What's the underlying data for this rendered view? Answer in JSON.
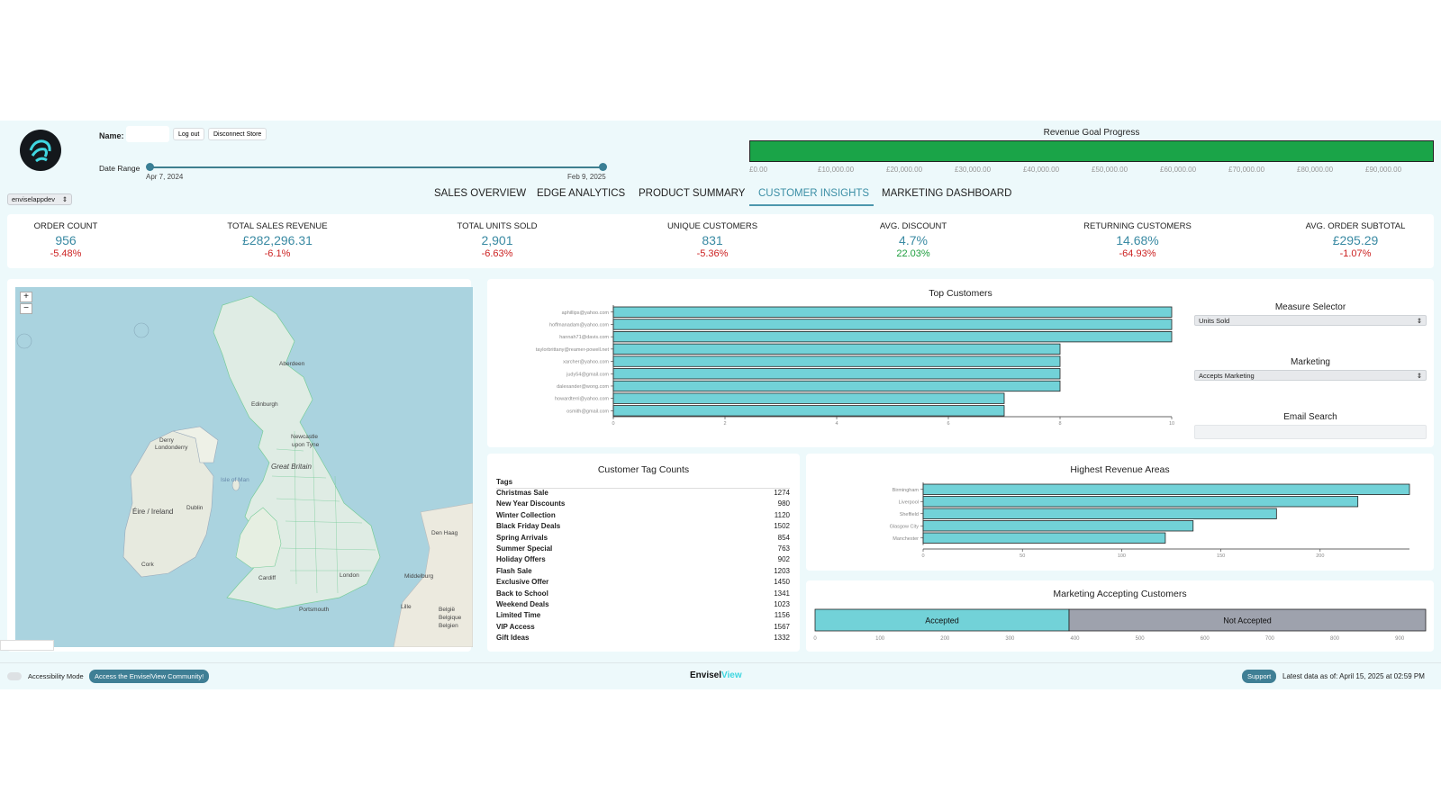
{
  "header": {
    "name_label": "Name:",
    "logout_label": "Log out",
    "disconnect_label": "Disconnect Store",
    "date_range_label": "Date Range",
    "date_start": "Apr 7, 2024",
    "date_end": "Feb 9, 2025",
    "store_select": "enviselappdev"
  },
  "goal": {
    "title": "Revenue Goal Progress",
    "progress_fraction": 1.0,
    "ticks": [
      "£0.00",
      "£10,000.00",
      "£20,000.00",
      "£30,000.00",
      "£40,000.00",
      "£50,000.00",
      "£60,000.00",
      "£70,000.00",
      "£80,000.00",
      "£90,000.00"
    ]
  },
  "tabs": [
    {
      "label": "SALES OVERVIEW",
      "active": false
    },
    {
      "label": "EDGE ANALYTICS",
      "active": false
    },
    {
      "label": "PRODUCT SUMMARY",
      "active": false
    },
    {
      "label": "CUSTOMER INSIGHTS",
      "active": true
    },
    {
      "label": "MARKETING DASHBOARD",
      "active": false
    }
  ],
  "kpis": [
    {
      "label": "ORDER COUNT",
      "value": "956",
      "change": "-5.48%",
      "trend": "neg"
    },
    {
      "label": "TOTAL SALES REVENUE",
      "value": "£282,296.31",
      "change": "-6.1%",
      "trend": "neg"
    },
    {
      "label": "TOTAL UNITS SOLD",
      "value": "2,901",
      "change": "-6.63%",
      "trend": "neg"
    },
    {
      "label": "UNIQUE CUSTOMERS",
      "value": "831",
      "change": "-5.36%",
      "trend": "neg"
    },
    {
      "label": "AVG. DISCOUNT",
      "value": "4.7%",
      "change": "22.03%",
      "trend": "pos"
    },
    {
      "label": "RETURNING CUSTOMERS",
      "value": "14.68%",
      "change": "-64.93%",
      "trend": "neg"
    },
    {
      "label": "AVG. ORDER SUBTOTAL",
      "value": "£295.29",
      "change": "-1.07%",
      "trend": "neg"
    }
  ],
  "map": {
    "zoom_in": "+",
    "zoom_out": "−",
    "labels": [
      {
        "text": "Aberdeen",
        "kind": "city"
      },
      {
        "text": "Edinburgh",
        "kind": "city"
      },
      {
        "text": "Newcastle",
        "kind": "city"
      },
      {
        "text": "upon Tyne",
        "kind": "city"
      },
      {
        "text": "Great Britain",
        "kind": "country"
      },
      {
        "text": "Derry",
        "kind": "city"
      },
      {
        "text": "Londonderry",
        "kind": "city"
      },
      {
        "text": "Isle of Man",
        "kind": "island"
      },
      {
        "text": "Éire / Ireland",
        "kind": "country"
      },
      {
        "text": "Dublin",
        "kind": "city"
      },
      {
        "text": "Cork",
        "kind": "city"
      },
      {
        "text": "Cardiff",
        "kind": "city"
      },
      {
        "text": "London",
        "kind": "city"
      },
      {
        "text": "Portsmouth",
        "kind": "city"
      },
      {
        "text": "Den Haag",
        "kind": "city"
      },
      {
        "text": "Middelburg",
        "kind": "city"
      },
      {
        "text": "Lille",
        "kind": "city"
      },
      {
        "text": "België",
        "kind": "country"
      },
      {
        "text": "Belgique",
        "kind": "country"
      },
      {
        "text": "Belgien",
        "kind": "country"
      }
    ]
  },
  "top_customers": {
    "title": "Top Customers",
    "chart_data": {
      "type": "bar",
      "orientation": "horizontal",
      "categories": [
        "aphillips@yahoo.com",
        "hoffmanadam@yahoo.com",
        "hannah71@davis.com",
        "taylorbrittany@reamer-powell.net",
        "xarcher@yahoo.com",
        "judy54@gmail.com",
        "dalexander@wong.com",
        "howardterri@yahoo.com",
        "osmith@gmail.com"
      ],
      "values": [
        10,
        10,
        10,
        8,
        8,
        8,
        8,
        7,
        7
      ],
      "xlim": [
        0,
        10
      ],
      "xticks": [
        "0",
        "2",
        "4",
        "6",
        "8",
        "10"
      ],
      "bar_color": "#72d2d8"
    }
  },
  "selectors": {
    "measure_label": "Measure Selector",
    "measure_value": "Units Sold",
    "marketing_label": "Marketing",
    "marketing_value": "Accepts Marketing",
    "email_label": "Email Search"
  },
  "tag_counts": {
    "title": "Customer Tag Counts",
    "header": "Tags",
    "rows": [
      {
        "tag": "Christmas Sale",
        "count": "1274"
      },
      {
        "tag": "New Year Discounts",
        "count": "980"
      },
      {
        "tag": "Winter Collection",
        "count": "1120"
      },
      {
        "tag": "Black Friday Deals",
        "count": "1502"
      },
      {
        "tag": "Spring Arrivals",
        "count": "854"
      },
      {
        "tag": "Summer Special",
        "count": "763"
      },
      {
        "tag": "Holiday Offers",
        "count": "902"
      },
      {
        "tag": "Flash Sale",
        "count": "1203"
      },
      {
        "tag": "Exclusive Offer",
        "count": "1450"
      },
      {
        "tag": "Back to School",
        "count": "1341"
      },
      {
        "tag": "Weekend Deals",
        "count": "1023"
      },
      {
        "tag": "Limited Time",
        "count": "1156"
      },
      {
        "tag": "VIP Access",
        "count": "1567"
      },
      {
        "tag": "Gift Ideas",
        "count": "1332"
      }
    ]
  },
  "revenue_areas": {
    "title": "Highest Revenue Areas",
    "chart_data": {
      "type": "bar",
      "orientation": "horizontal",
      "categories": [
        "Birmingham",
        "Liverpool",
        "Sheffield",
        "Glasgow City",
        "Manchester"
      ],
      "values": [
        245,
        219,
        178,
        136,
        122
      ],
      "xlim": [
        0,
        245
      ],
      "xticks": [
        "0",
        "50",
        "100",
        "150",
        "200"
      ],
      "bar_color": "#72d2d8"
    }
  },
  "marketing": {
    "title": "Marketing Accepting Customers",
    "chart_data": {
      "type": "bar",
      "orientation": "stacked-horizontal",
      "segments": [
        {
          "name": "Accepted",
          "value": 391,
          "color": "#72d2d8"
        },
        {
          "name": "Not Accepted",
          "value": 549,
          "color": "#9ea2ad"
        }
      ],
      "xlim": [
        0,
        940
      ],
      "xticks": [
        "0",
        "100",
        "200",
        "300",
        "400",
        "500",
        "600",
        "700",
        "800",
        "900"
      ]
    }
  },
  "footer": {
    "accessibility_label": "Accessibility Mode",
    "community_label": "Access the EnviselView Community!",
    "brand_left": "Envisel",
    "brand_right": "View",
    "support_label": "Support",
    "latest_data": "Latest data as of: April 15, 2025 at 02:59 PM"
  },
  "colors": {
    "accent": "#3c8fa6",
    "bar": "#72d2d8",
    "goal": "#1aa448",
    "negative": "#cc2222",
    "positive": "#1e9e3e",
    "background": "#edf9fb"
  }
}
